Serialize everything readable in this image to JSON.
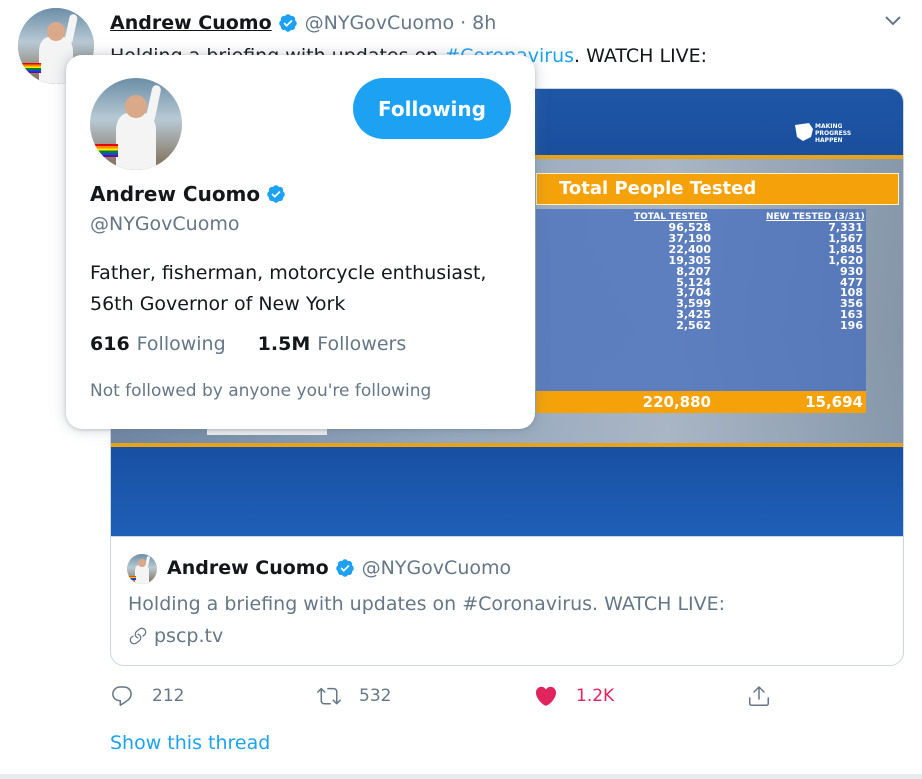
{
  "tweet": {
    "name": "Andrew Cuomo",
    "handle": "@NYGovCuomo",
    "separator": "·",
    "time": "8h",
    "text_prefix": "Holding a briefing with updates on ",
    "hashtag": "#Coronavirus",
    "text_suffix": ". WATCH LIVE:"
  },
  "media": {
    "logo_line1": "MAKING",
    "logo_line2": "PROGRESS",
    "logo_line3": "HAPPEN",
    "table_title": "Total People Tested",
    "col_total_header": "TOTAL TESTED",
    "col_new_header": "NEW TESTED (3/31)",
    "total_tested": [
      "96,528",
      "37,190",
      "22,400",
      "19,305",
      "8,207",
      "5,124",
      "3,704",
      "3,599",
      "3,425",
      "2,562"
    ],
    "new_tested": [
      "7,331",
      "1,567",
      "1,845",
      "1,620",
      "930",
      "477",
      "108",
      "356",
      "163",
      "196"
    ],
    "sum_total": "220,880",
    "sum_new": "15,694"
  },
  "quote": {
    "name": "Andrew Cuomo",
    "handle": "@NYGovCuomo",
    "text": "Holding a briefing with updates on #Coronavirus. WATCH LIVE:",
    "link": "pscp.tv"
  },
  "actions": {
    "reply_count": "212",
    "retweet_count": "532",
    "like_count": "1.2K"
  },
  "show_thread": "Show this thread",
  "hovercard": {
    "follow_label": "Following",
    "name": "Andrew Cuomo",
    "handle": "@NYGovCuomo",
    "bio_line1": "Father, fisherman, motorcycle enthusiast,",
    "bio_line2": "56th Governor of New York",
    "following_count": "616",
    "following_label": "Following",
    "followers_count": "1.5M",
    "followers_label": "Followers",
    "note": "Not followed by anyone you're following"
  },
  "colors": {
    "accent": "#1da1f2",
    "like": "#e0245e",
    "muted": "#657786",
    "table_orange": "#f5a20a"
  }
}
